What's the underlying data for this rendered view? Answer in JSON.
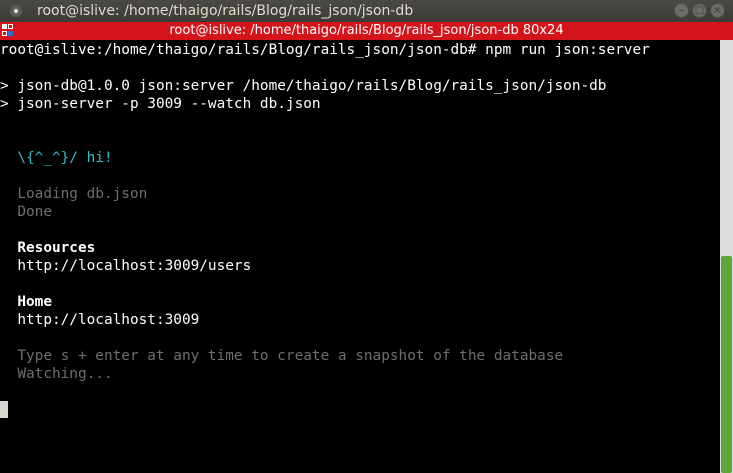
{
  "window": {
    "title": "root@islive: /home/thaigo/rails/Blog/rails_json/json-db",
    "minimize_label": "–",
    "maximize_label": "□",
    "close_label": "×"
  },
  "tab": {
    "title": "root@islive: /home/thaigo/rails/Blog/rails_json/json-db 80x24"
  },
  "terminal": {
    "lines": [
      "root@islive:/home/thaigo/rails/Blog/rails_json/json-db# npm run json:server",
      "",
      "> json-db@1.0.0 json:server /home/thaigo/rails/Blog/rails_json/json-db",
      "> json-server -p 3009 --watch db.json",
      "",
      "",
      "  \\{^_^}/ hi!",
      "",
      "  Loading db.json",
      "  Done",
      "",
      "  Resources",
      "  http://localhost:3009/users",
      "",
      "  Home",
      "  http://localhost:3009",
      "",
      "  Type s + enter at any time to create a snapshot of the database",
      "  Watching..."
    ]
  },
  "colors": {
    "tabbar": "#d3151b",
    "cyan": "#2fbcc4",
    "dim": "#6e6e6e",
    "scroll_thumb": "#5ea63a"
  }
}
